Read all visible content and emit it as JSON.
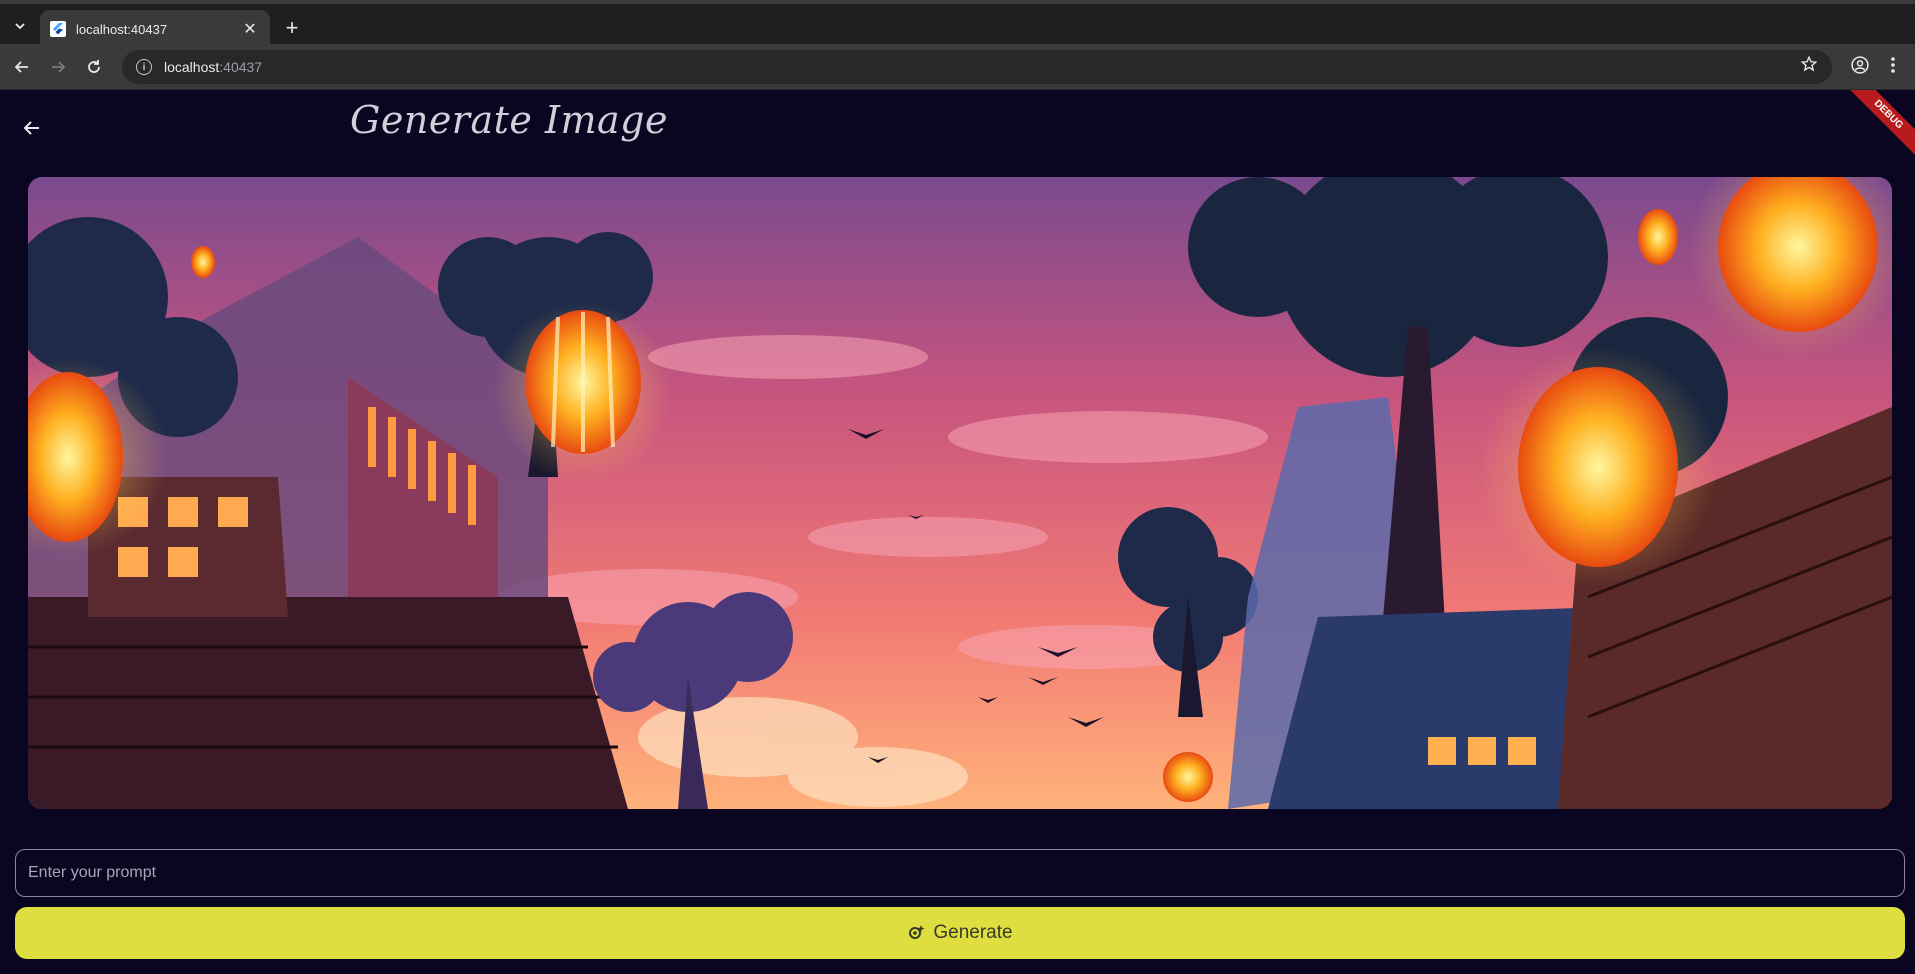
{
  "browser": {
    "tab_title": "localhost:40437",
    "url_host": "localhost",
    "url_port": ":40437",
    "icons": {
      "tab_list": "chevron-down-icon",
      "favicon": "flutter-icon",
      "tab_close": "close-icon",
      "new_tab": "plus-icon",
      "back": "arrow-left-icon",
      "forward": "arrow-right-icon",
      "reload": "reload-icon",
      "site_info": "info-icon",
      "bookmark": "star-icon",
      "profile": "profile-icon",
      "menu": "kebab-menu-icon"
    }
  },
  "app": {
    "title": "Generate Image",
    "debug_banner": "DEBUG",
    "prompt": {
      "placeholder": "Enter your prompt",
      "value": ""
    },
    "generate_button": {
      "label": "Generate",
      "icon": "sparkle-camera-icon"
    },
    "colors": {
      "background": "#0a0520",
      "button_bg": "#dede40",
      "button_text": "#3a3a2a",
      "debug_banner": "#b71c1c"
    }
  }
}
